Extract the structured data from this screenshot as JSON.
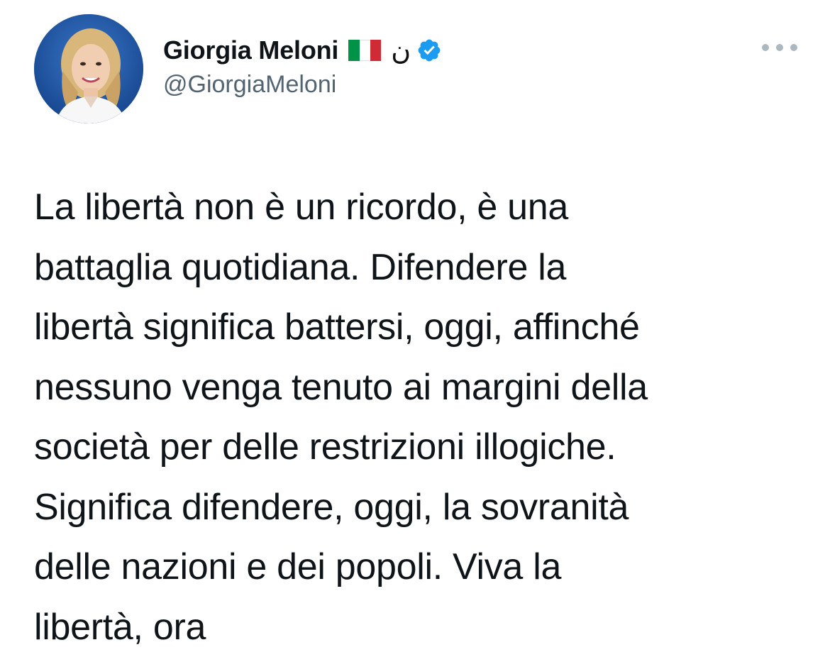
{
  "author": {
    "display_name": "Giorgia Meloni",
    "handle": "@GiorgiaMeloni",
    "badges": {
      "flag": "italy-flag-icon",
      "emoji": "ن",
      "verified": "verified-badge-icon"
    },
    "avatar": "profile-photo"
  },
  "tweet": {
    "lines": [
      "La libertà non è un ricordo, è una",
      "battaglia quotidiana. Difendere la",
      "libertà significa battersi, oggi, affinché",
      "nessuno venga tenuto ai margini della",
      "società per delle restrizioni illogiche.",
      "Significa difendere, oggi, la sovranità",
      "delle nazioni e dei popoli. Viva la",
      "libertà, ora"
    ]
  },
  "icons": {
    "more": "more-options-icon"
  },
  "colors": {
    "text": "#0f1419",
    "secondary": "#536471",
    "verified": "#1d9bf0",
    "flag_green": "#009246",
    "flag_white": "#ffffff",
    "flag_red": "#ce2b37"
  }
}
